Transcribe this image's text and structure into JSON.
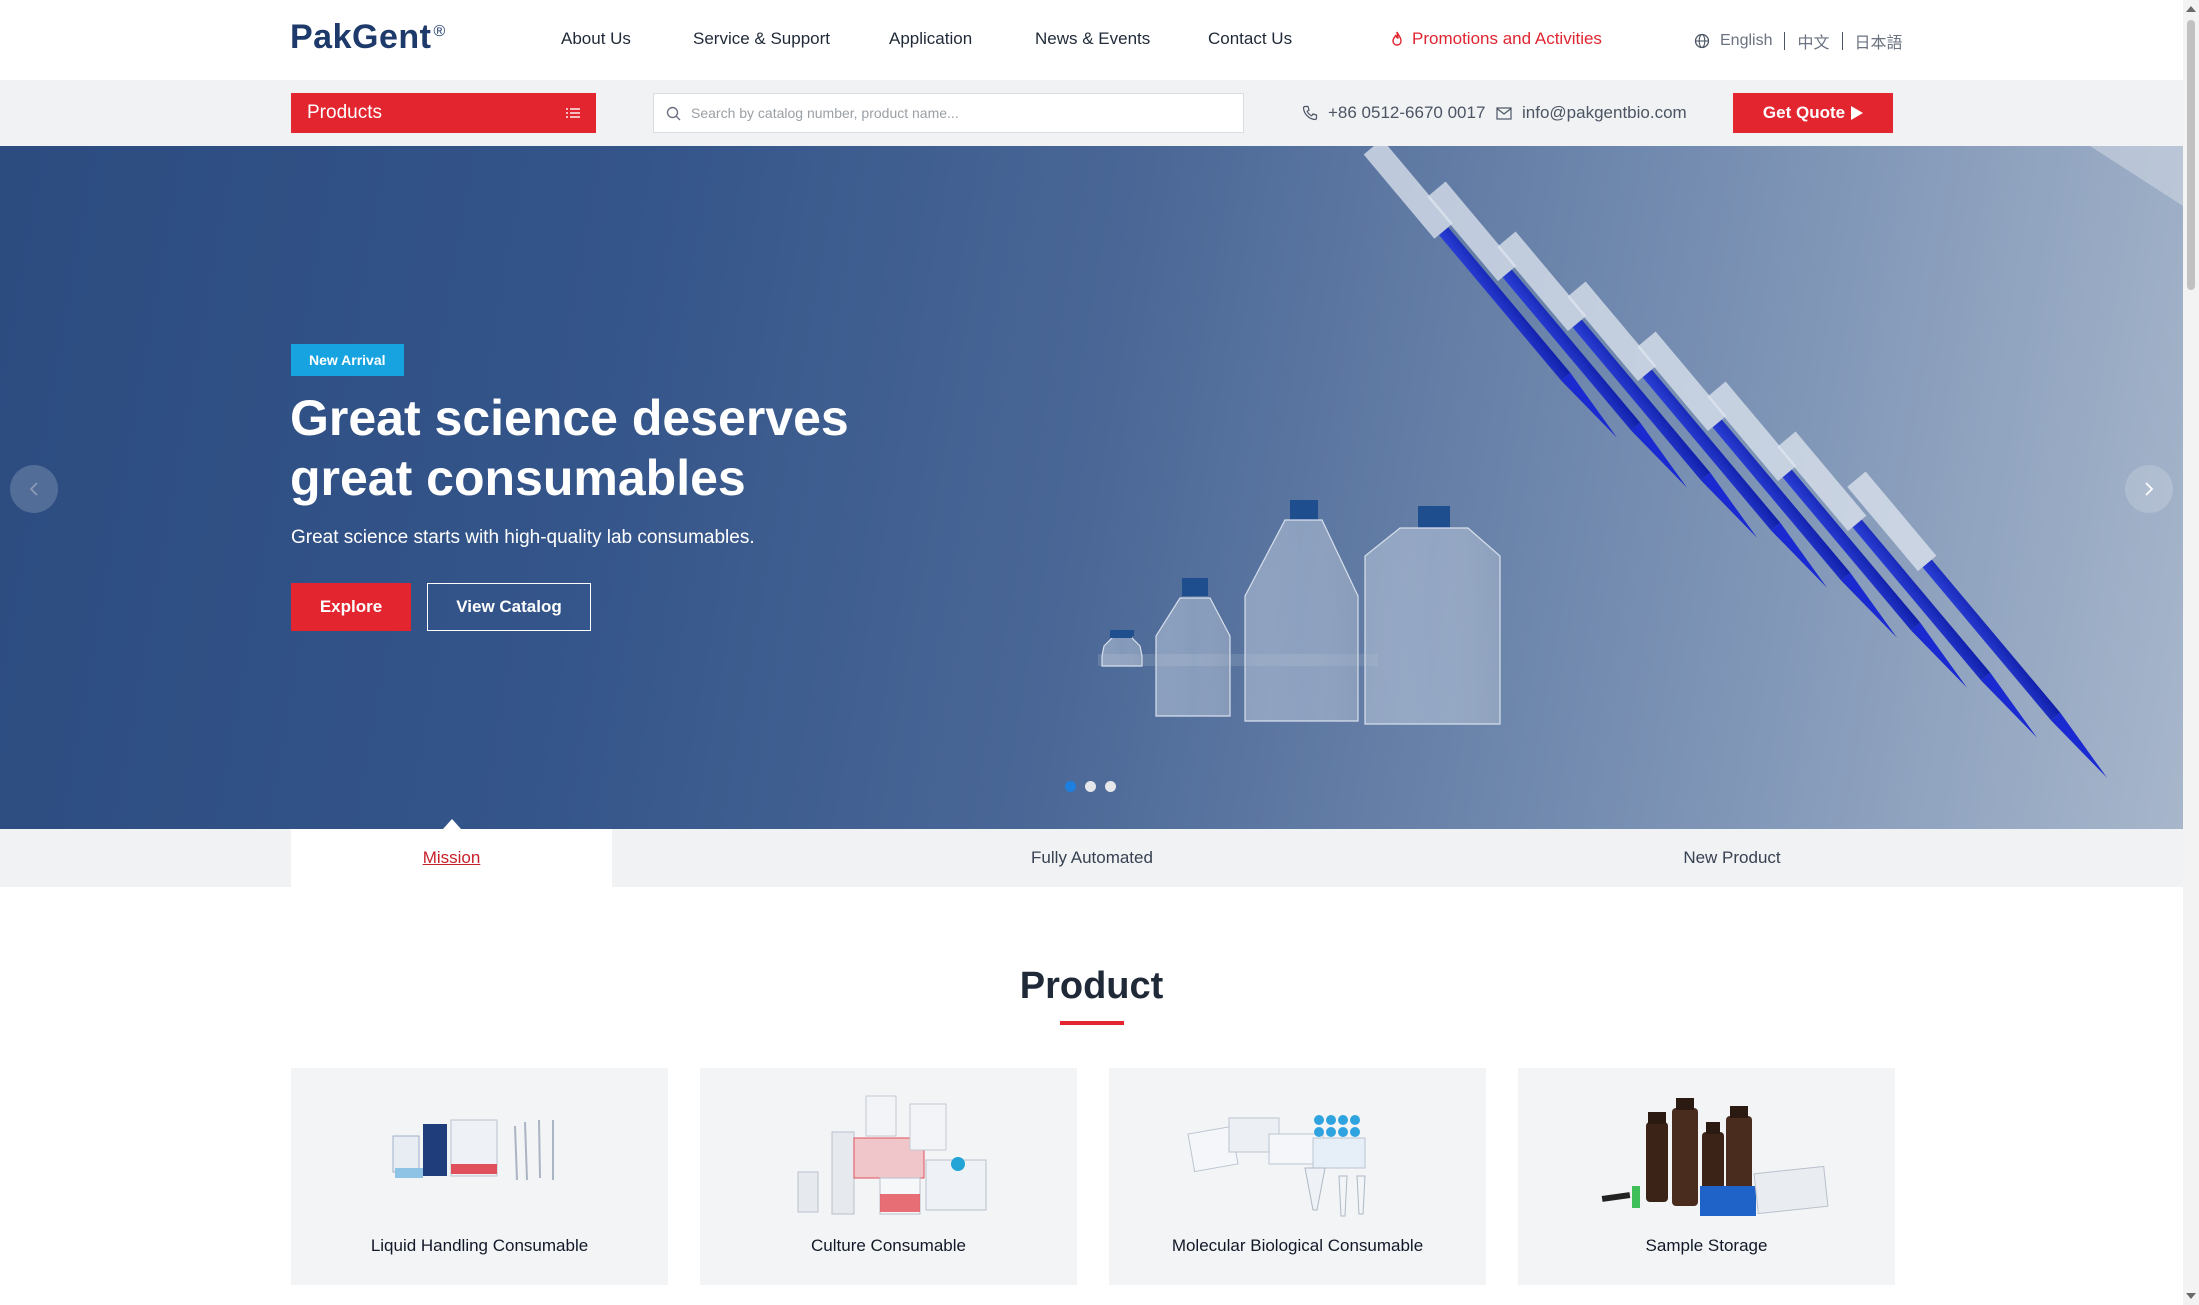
{
  "brand": {
    "name": "PakGent",
    "mark": "®"
  },
  "nav": {
    "links": [
      "About Us",
      "Service & Support",
      "Application",
      "News & Events",
      "Contact Us"
    ],
    "promotion": "Promotions and Activities",
    "languages": [
      "English",
      "中文",
      "日本語"
    ]
  },
  "subbar": {
    "products_label": "Products",
    "search_placeholder": "Search by catalog number, product name...",
    "phone": "+86 0512-6670 0017",
    "email": "info@pakgentbio.com",
    "quote_label": "Get Quote"
  },
  "hero": {
    "badge": "New Arrival",
    "title_line1": "Great science deserves",
    "title_line2": "great consumables",
    "subtitle": "Great science starts with high-quality lab consumables.",
    "explore_label": "Explore",
    "catalog_label": "View Catalog",
    "slide_count": 3,
    "active_slide": 1
  },
  "tabs": {
    "items": [
      "Mission",
      "Fully Automated",
      "New Product"
    ],
    "active": "Mission"
  },
  "product_section": {
    "title": "Product",
    "cards": [
      "Liquid Handling Consumable",
      "Culture Consumable",
      "Molecular Biological Consumable",
      "Sample Storage"
    ]
  },
  "colors": {
    "accent": "#e32530",
    "brand": "#1d3a6b",
    "badge": "#16a3e0",
    "dot_active": "#1d7fe0"
  },
  "icons": [
    "flame-icon",
    "globe-icon",
    "menu-list-icon",
    "search-icon",
    "phone-icon",
    "mail-icon",
    "play-icon",
    "chevron-left-icon",
    "chevron-right-icon"
  ]
}
